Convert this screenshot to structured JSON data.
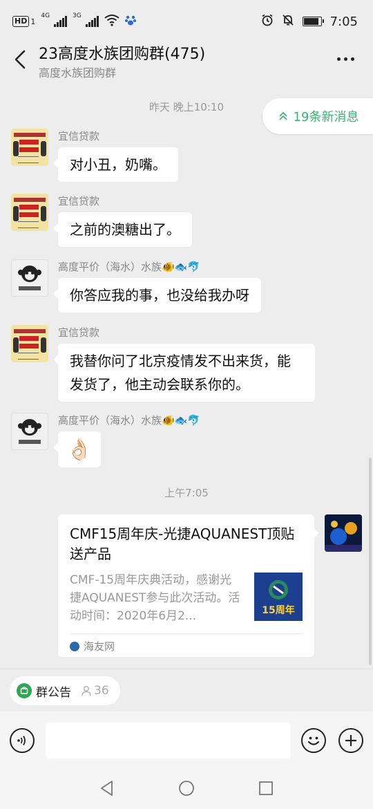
{
  "status_bar": {
    "hd_label": "HD",
    "hd_sub": "1",
    "signal1_label": "4G",
    "signal2_label": "3G",
    "time": "7:05",
    "battery_level": 0.9
  },
  "header": {
    "title": "23高度水族团购群(475)",
    "subtitle": "高度水族团购群"
  },
  "chat": {
    "new_messages": "19条新消息",
    "timestamp1": "昨天 晚上10:10",
    "timestamp2": "上午7:05",
    "messages": [
      {
        "sender": "宜信贷款",
        "text": "对小丑，奶嘴。"
      },
      {
        "sender": "宜信贷款",
        "text": "之前的澳糖出了。"
      },
      {
        "sender": "高度平价（海水）水族🐠🐟🐬",
        "text": "你答应我的事，也没给我办呀"
      },
      {
        "sender": "宜信贷款",
        "text": "我替你问了北京疫情发不出来货，能发货了，他主动会联系你的。"
      },
      {
        "sender": "高度平价（海水）水族🐠🐟🐬",
        "emoji": "👌🏻"
      }
    ],
    "card": {
      "title": "CMF15周年庆-光捷AQUANEST顶贴送产品",
      "description": "CMF-15周年庆典活动，感谢光捷AQUANEST参与此次活动。活动时间：2020年6月2...",
      "thumb_text": "15周年",
      "source": "海友网"
    }
  },
  "notice_bar": {
    "label": "群公告",
    "count": "36"
  },
  "colors": {
    "accent_green": "#3cb371",
    "bubble": "#ffffff",
    "background": "#ededed"
  }
}
